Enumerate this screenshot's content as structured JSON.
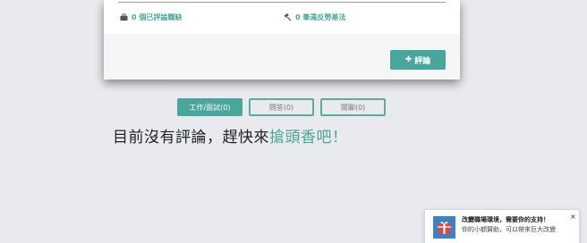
{
  "stats": {
    "interviews": "0 個已評論職缺",
    "violations": "0 筆違反勞基法"
  },
  "review_button": {
    "icon": "plus-icon",
    "label": "評論"
  },
  "tabs": [
    {
      "label": "工作/面試(0)",
      "active": true
    },
    {
      "label": "問答(0)",
      "active": false
    },
    {
      "label": "閒聊(0)",
      "active": false
    }
  ],
  "empty_state": {
    "prefix": "目前沒有評論，趕快來",
    "link": "搶頭香吧！"
  },
  "notification": {
    "title": "改變職場環境，需要你的支持！",
    "body": "你的小額贊助，可以帶來巨大改變",
    "close": "×",
    "icon": "gift-icon"
  },
  "colors": {
    "accent": "#48a79a",
    "background": "#e9eaed"
  }
}
